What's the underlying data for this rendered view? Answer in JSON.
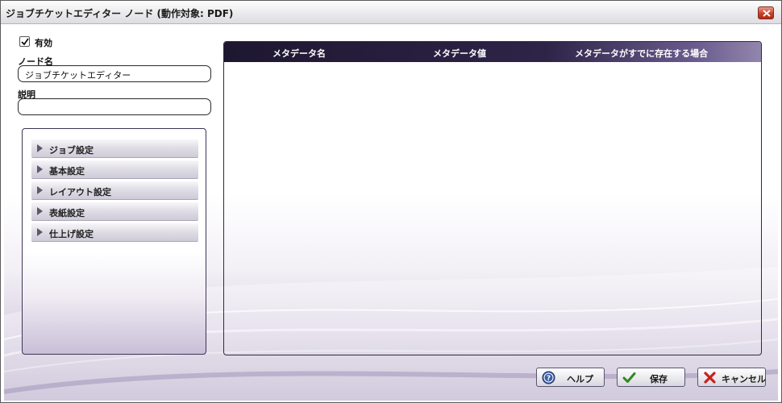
{
  "window": {
    "title": "ジョブチケットエディター ノード (動作対象: PDF)"
  },
  "form": {
    "enabled_label": "有効",
    "enabled_checked": true,
    "node_name_label": "ノード名",
    "node_name_value": "ジョブチケットエディター",
    "description_label": "説明",
    "description_value": ""
  },
  "settings": {
    "items": [
      {
        "label": "ジョブ設定"
      },
      {
        "label": "基本設定"
      },
      {
        "label": "レイアウト設定"
      },
      {
        "label": "表紙設定"
      },
      {
        "label": "仕上げ設定"
      }
    ]
  },
  "metadata_table": {
    "columns": [
      "メタデータ名",
      "メタデータ値",
      "メタデータがすでに存在する場合"
    ],
    "rows": []
  },
  "buttons": {
    "help": "ヘルプ",
    "save": "保存",
    "cancel": "キャンセル"
  },
  "colors": {
    "accent": "#2e2448",
    "close": "#c9412b"
  }
}
